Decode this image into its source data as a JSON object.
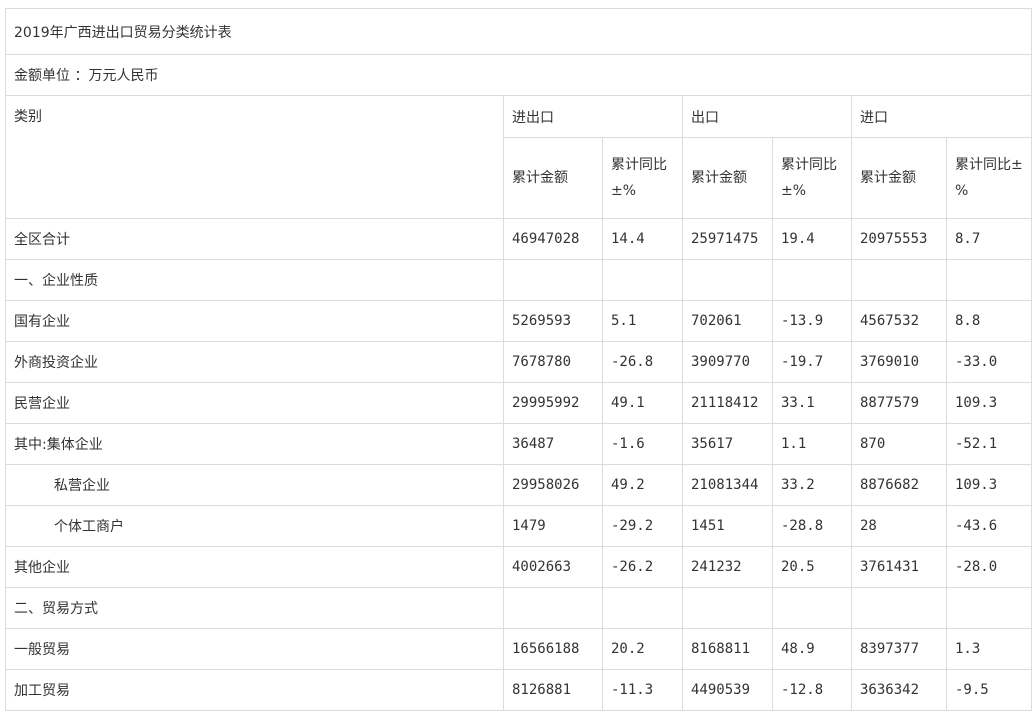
{
  "title": "2019年广西进出口贸易分类统计表",
  "unit": "金额单位 ：万元人民币",
  "headers": {
    "category": "类别",
    "groups": [
      "进出口",
      "出口",
      "进口"
    ],
    "sub": [
      "累计金额",
      "累计同比±%",
      "累计金额",
      "累计同比±%",
      "累计金额",
      "累计同比±%"
    ]
  },
  "rows": [
    {
      "label": "全区合计",
      "values": [
        "46947028",
        "14.4",
        "25971475",
        "19.4",
        "20975553",
        "8.7"
      ]
    },
    {
      "label": "一、企业性质",
      "values": [
        "",
        "",
        "",
        "",
        "",
        ""
      ]
    },
    {
      "label": "国有企业",
      "values": [
        "5269593",
        "5.1",
        "702061",
        "-13.9",
        "4567532",
        "8.8"
      ]
    },
    {
      "label": "外商投资企业",
      "values": [
        "7678780",
        "-26.8",
        "3909770",
        "-19.7",
        "3769010",
        "-33.0"
      ]
    },
    {
      "label": "民营企业",
      "values": [
        "29995992",
        "49.1",
        "21118412",
        "33.1",
        "8877579",
        "109.3"
      ]
    },
    {
      "label": "其中:集体企业",
      "values": [
        "36487",
        "-1.6",
        "35617",
        "1.1",
        "870",
        "-52.1"
      ]
    },
    {
      "label": "私营企业",
      "values": [
        "29958026",
        "49.2",
        "21081344",
        "33.2",
        "8876682",
        "109.3"
      ]
    },
    {
      "label": "个体工商户",
      "values": [
        "1479",
        "-29.2",
        "1451",
        "-28.8",
        "28",
        "-43.6"
      ]
    },
    {
      "label": "其他企业",
      "values": [
        "4002663",
        "-26.2",
        "241232",
        "20.5",
        "3761431",
        "-28.0"
      ]
    },
    {
      "label": "二、贸易方式",
      "values": [
        "",
        "",
        "",
        "",
        "",
        ""
      ]
    },
    {
      "label": "一般贸易",
      "values": [
        "16566188",
        "20.2",
        "8168811",
        "48.9",
        "8397377",
        "1.3"
      ]
    },
    {
      "label": "加工贸易",
      "values": [
        "8126881",
        "-11.3",
        "4490539",
        "-12.8",
        "3636342",
        "-9.5"
      ]
    }
  ]
}
